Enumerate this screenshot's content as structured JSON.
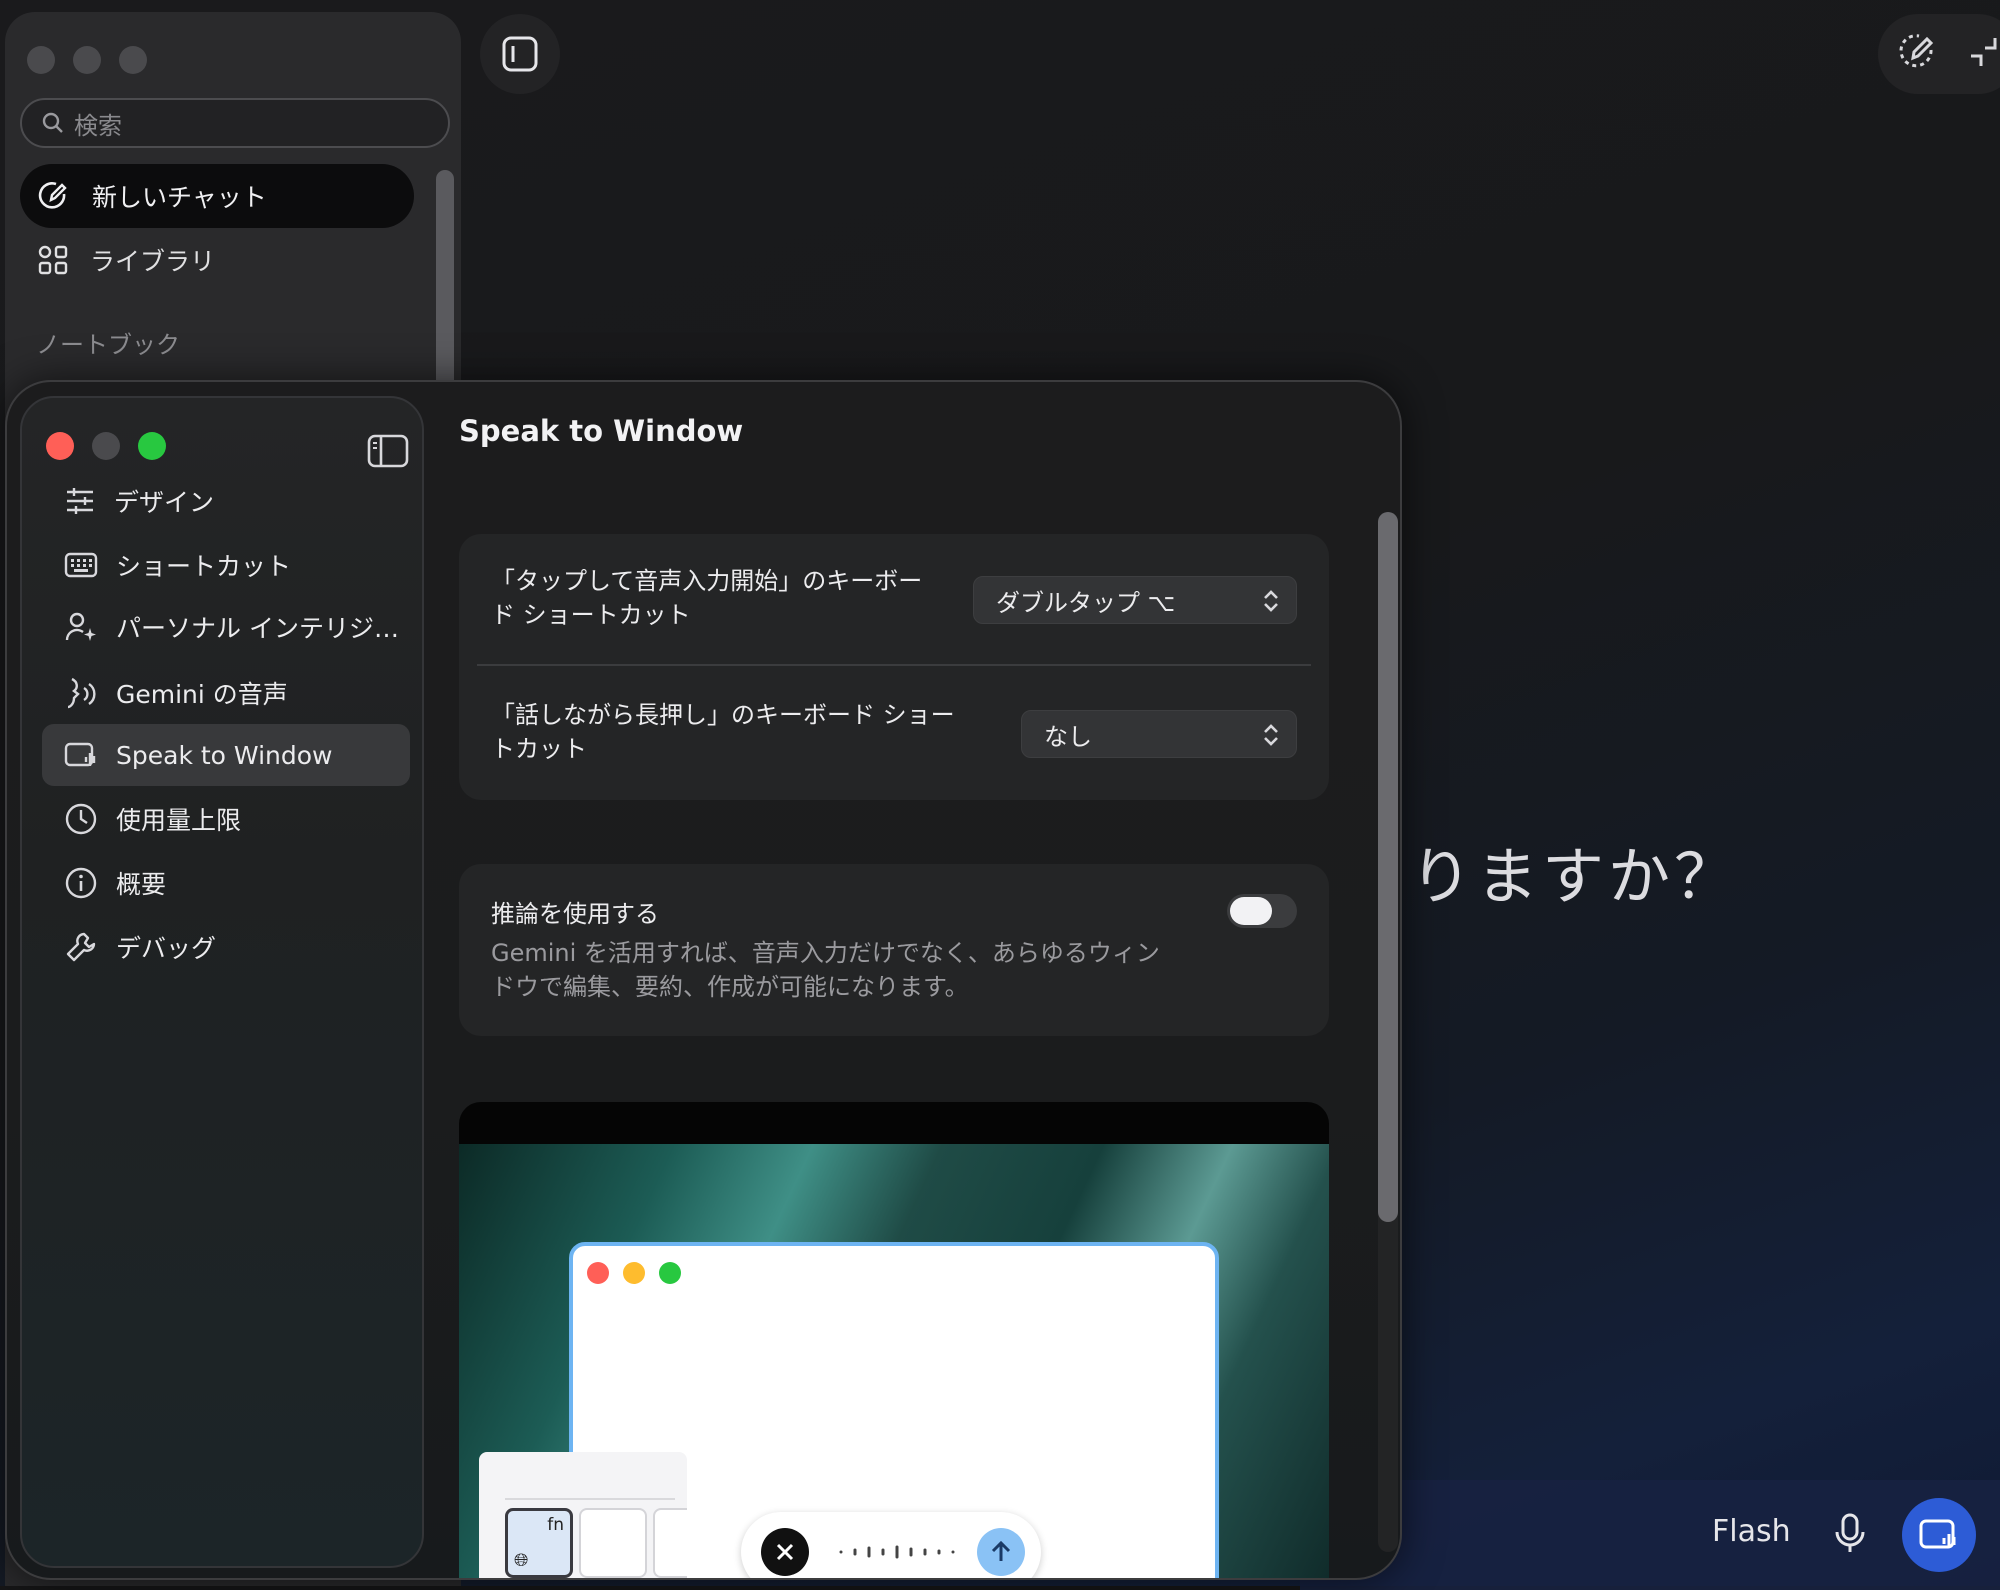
{
  "background_app": {
    "search_placeholder": "検索",
    "new_chat_label": "新しいチャット",
    "library_label": "ライブラリ",
    "notebook_heading": "ノートブック",
    "greeting_partial": "りますか？",
    "model_label": "Flash"
  },
  "settings": {
    "title": "Speak to Window",
    "sidebar": {
      "items": [
        {
          "label": "デザイン",
          "icon": "sliders-icon"
        },
        {
          "label": "ショートカット",
          "icon": "keyboard-icon"
        },
        {
          "label": "パーソナル インテリジ…",
          "icon": "person-sparkle-icon"
        },
        {
          "label": "Gemini の音声",
          "icon": "voice-icon"
        },
        {
          "label": "Speak to Window",
          "icon": "window-voice-icon",
          "active": true
        },
        {
          "label": "使用量上限",
          "icon": "clock-icon"
        },
        {
          "label": "概要",
          "icon": "info-icon"
        },
        {
          "label": "デバッグ",
          "icon": "wrench-icon"
        }
      ]
    },
    "shortcuts": {
      "tap_label": "「タップして音声入力開始」のキーボード ショートカット",
      "tap_value": "ダブルタップ ⌥",
      "hold_label": "「話しながら長押し」のキーボード ショートカット",
      "hold_value": "なし"
    },
    "reasoning": {
      "title": "推論を使用する",
      "description": "Gemini を活用すれば、音声入力だけでなく、あらゆるウィンドウで編集、要約、作成が可能になります。",
      "enabled": false
    },
    "illustration": {
      "key_label": "fn"
    }
  },
  "colors": {
    "close": "#ff5f57",
    "minimize_inactive": "#4a4a4d",
    "zoom": "#28c840",
    "accent_blue": "#2d5cd6"
  }
}
